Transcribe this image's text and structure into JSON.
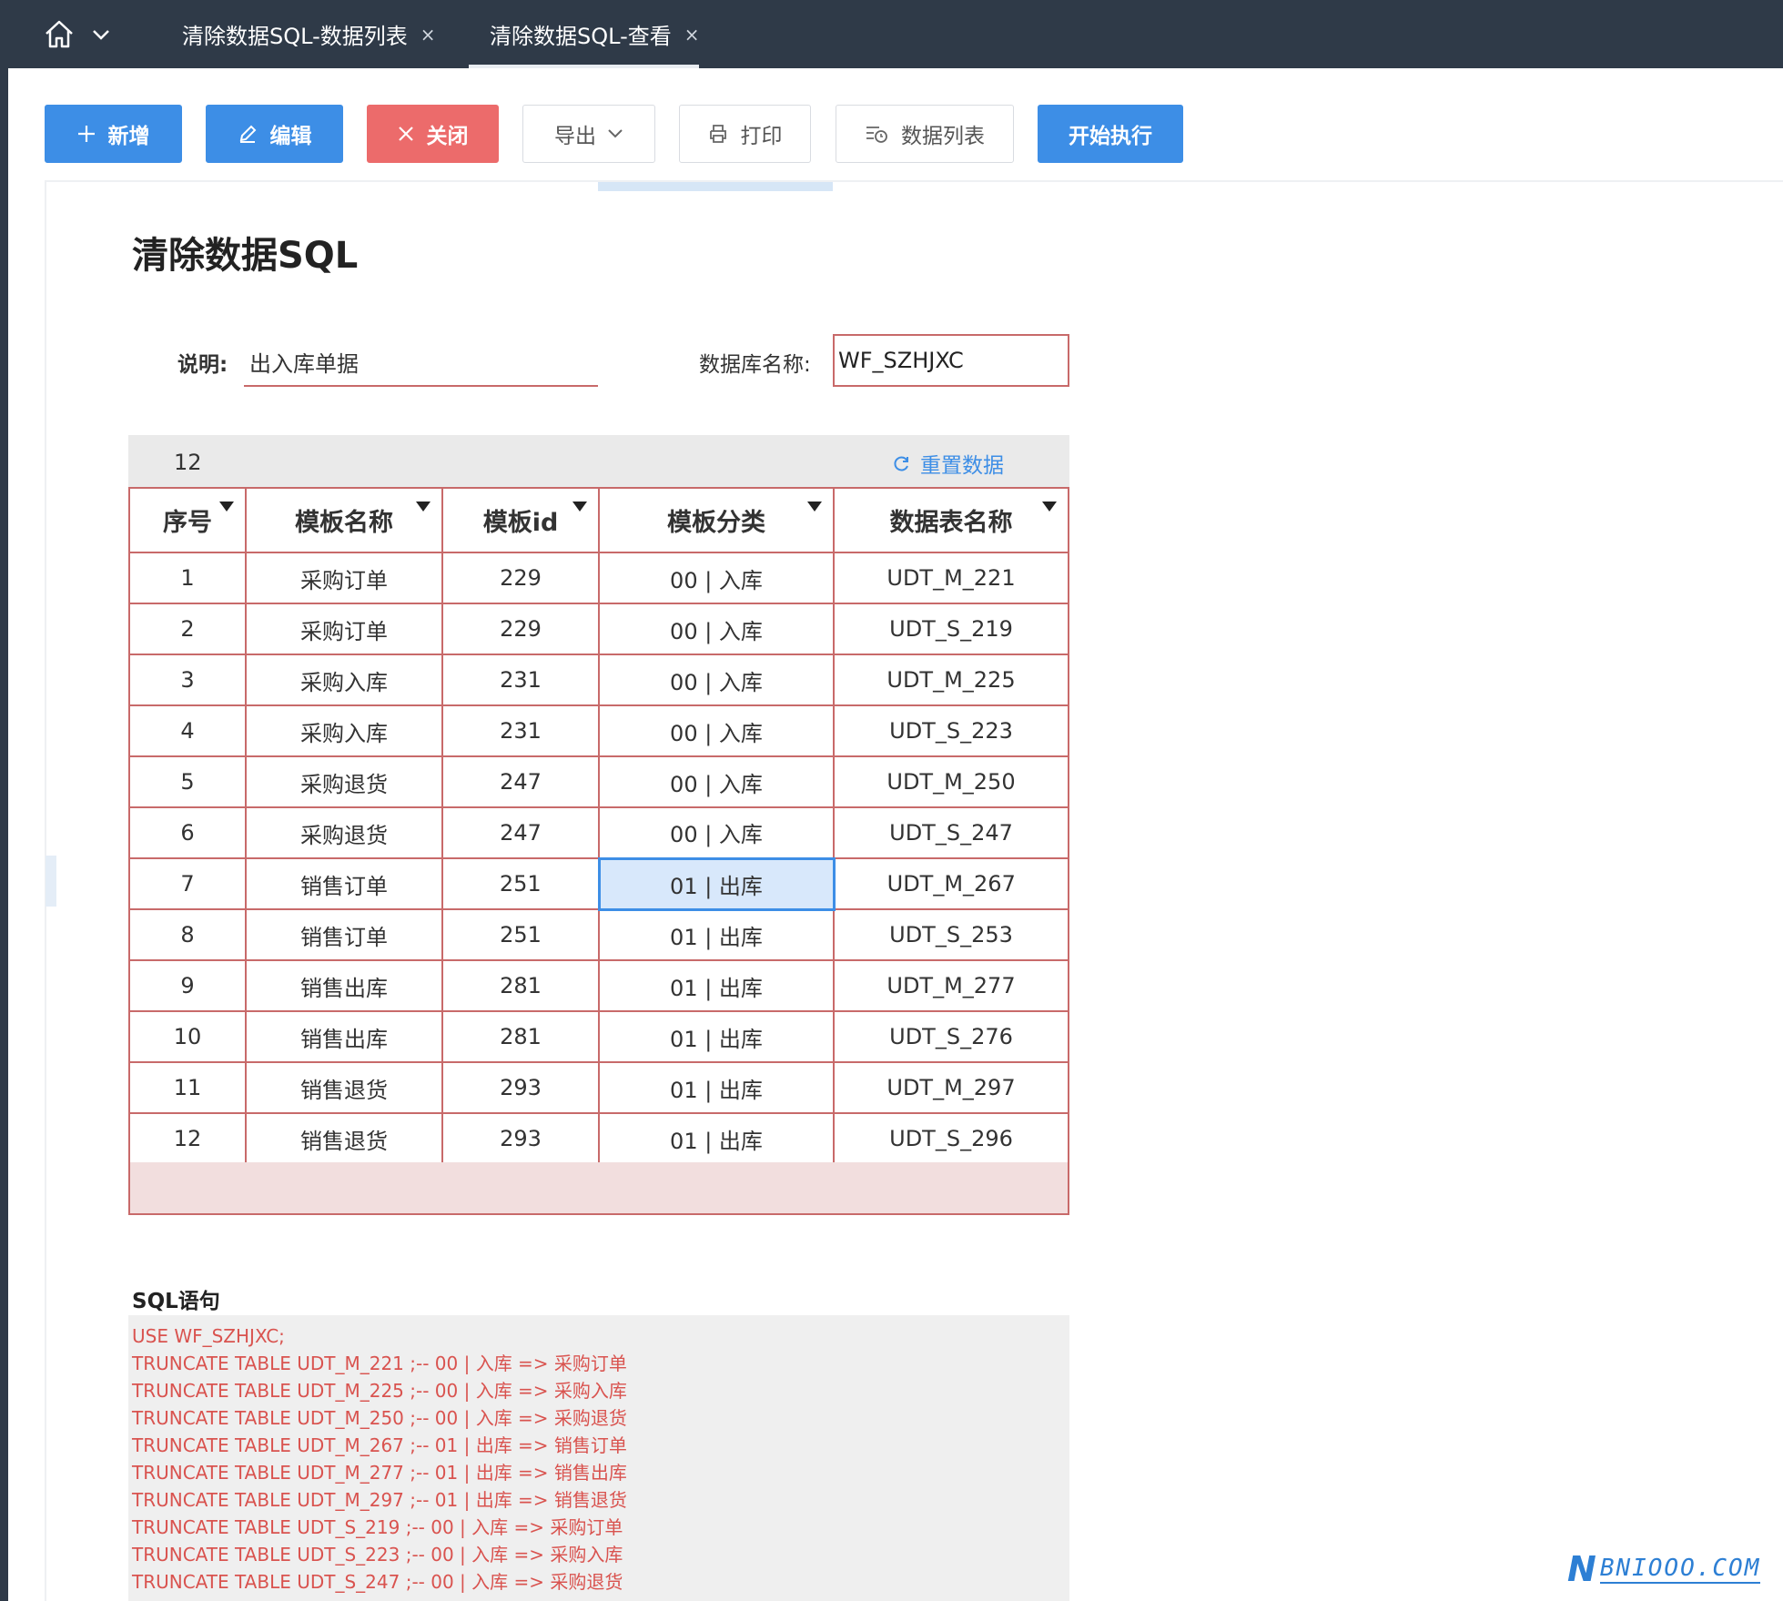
{
  "tabs": [
    {
      "label": "清除数据SQL-数据列表",
      "close": "×"
    },
    {
      "label": "清除数据SQL-查看",
      "close": "×"
    }
  ],
  "toolbar": {
    "add": "新增",
    "edit": "编辑",
    "close": "关闭",
    "export": "导出",
    "print": "打印",
    "data_list": "数据列表",
    "run": "开始执行"
  },
  "page": {
    "title": "清除数据SQL",
    "desc_label": "说明:",
    "desc_value": "出入库单据",
    "db_label": "数据库名称:",
    "db_value": "WF_SZHJXC"
  },
  "grid": {
    "count": "12",
    "reset": "重置数据",
    "columns": [
      "序号",
      "模板名称",
      "模板id",
      "模板分类",
      "数据表名称"
    ],
    "rows": [
      [
        "1",
        "采购订单",
        "229",
        "00 | 入库",
        "UDT_M_221"
      ],
      [
        "2",
        "采购订单",
        "229",
        "00 | 入库",
        "UDT_S_219"
      ],
      [
        "3",
        "采购入库",
        "231",
        "00 | 入库",
        "UDT_M_225"
      ],
      [
        "4",
        "采购入库",
        "231",
        "00 | 入库",
        "UDT_S_223"
      ],
      [
        "5",
        "采购退货",
        "247",
        "00 | 入库",
        "UDT_M_250"
      ],
      [
        "6",
        "采购退货",
        "247",
        "00 | 入库",
        "UDT_S_247"
      ],
      [
        "7",
        "销售订单",
        "251",
        "01 | 出库",
        "UDT_M_267"
      ],
      [
        "8",
        "销售订单",
        "251",
        "01 | 出库",
        "UDT_S_253"
      ],
      [
        "9",
        "销售出库",
        "281",
        "01 | 出库",
        "UDT_M_277"
      ],
      [
        "10",
        "销售出库",
        "281",
        "01 | 出库",
        "UDT_S_276"
      ],
      [
        "11",
        "销售退货",
        "293",
        "01 | 出库",
        "UDT_M_297"
      ],
      [
        "12",
        "销售退货",
        "293",
        "01 | 出库",
        "UDT_S_296"
      ]
    ],
    "selected": {
      "row": 6,
      "col": 3
    }
  },
  "sql": {
    "label": "SQL语句",
    "lines": [
      "USE WF_SZHJXC;",
      "TRUNCATE TABLE UDT_M_221 ;-- 00 | 入库 => 采购订单",
      "TRUNCATE TABLE UDT_M_225 ;-- 00 | 入库 => 采购入库",
      "TRUNCATE TABLE UDT_M_250 ;-- 00 | 入库 => 采购退货",
      "TRUNCATE TABLE UDT_M_267 ;-- 01 | 出库 => 销售订单",
      "TRUNCATE TABLE UDT_M_277 ;-- 01 | 出库 => 销售出库",
      "TRUNCATE TABLE UDT_M_297 ;-- 01 | 出库 => 销售退货",
      "TRUNCATE TABLE UDT_S_219 ;-- 00 | 入库 => 采购订单",
      "TRUNCATE TABLE UDT_S_223 ;-- 00 | 入库 => 采购入库",
      "TRUNCATE TABLE UDT_S_247 ;-- 00 | 入库 => 采购退货"
    ]
  },
  "watermark": {
    "n": "N",
    "rest": "BNIOOO.COM"
  },
  "colors": {
    "topbar": "#2f3a48",
    "primary": "#3d8ee6",
    "danger": "#ec6b6b",
    "grid_border": "#c86a6a",
    "sql_text": "#d9534f"
  }
}
